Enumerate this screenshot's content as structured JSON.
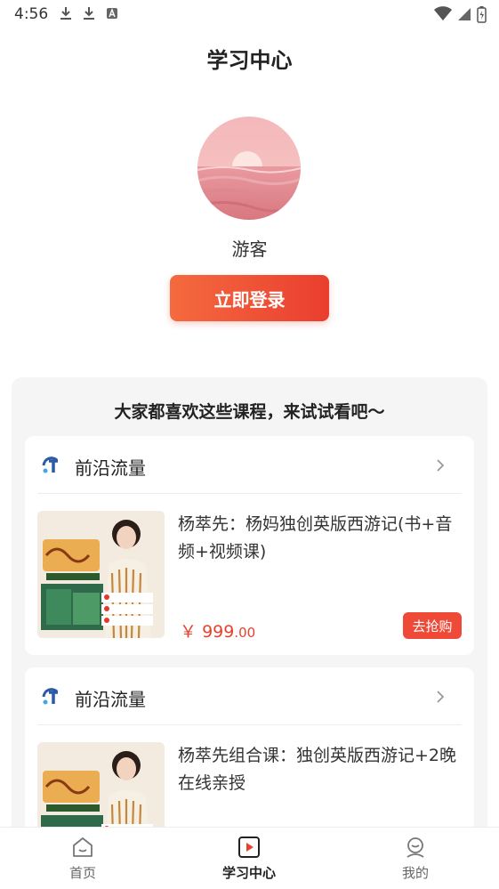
{
  "status_bar": {
    "time": "4:56"
  },
  "header": {
    "title": "学习中心"
  },
  "profile": {
    "username": "游客",
    "login_label": "立即登录"
  },
  "recommend": {
    "title": "大家都喜欢这些课程，来试试看吧～",
    "cards": [
      {
        "provider": "前沿流量",
        "course_title": "杨萃先：杨妈独创英版西游记(书+音频+视频课)",
        "price_symbol": "￥",
        "price_int": "999",
        "price_dec": ".00",
        "buy_label": "去抢购"
      },
      {
        "provider": "前沿流量",
        "course_title": "杨萃先组合课：独创英版西游记+2晚在线亲授"
      }
    ]
  },
  "bottom_nav": {
    "items": [
      {
        "label": "首页",
        "icon": "home-icon"
      },
      {
        "label": "学习中心",
        "icon": "play-icon",
        "active": true
      },
      {
        "label": "我的",
        "icon": "profile-icon"
      }
    ]
  },
  "colors": {
    "accent": "#ea3e2f",
    "accent_light": "#f46a3f"
  }
}
